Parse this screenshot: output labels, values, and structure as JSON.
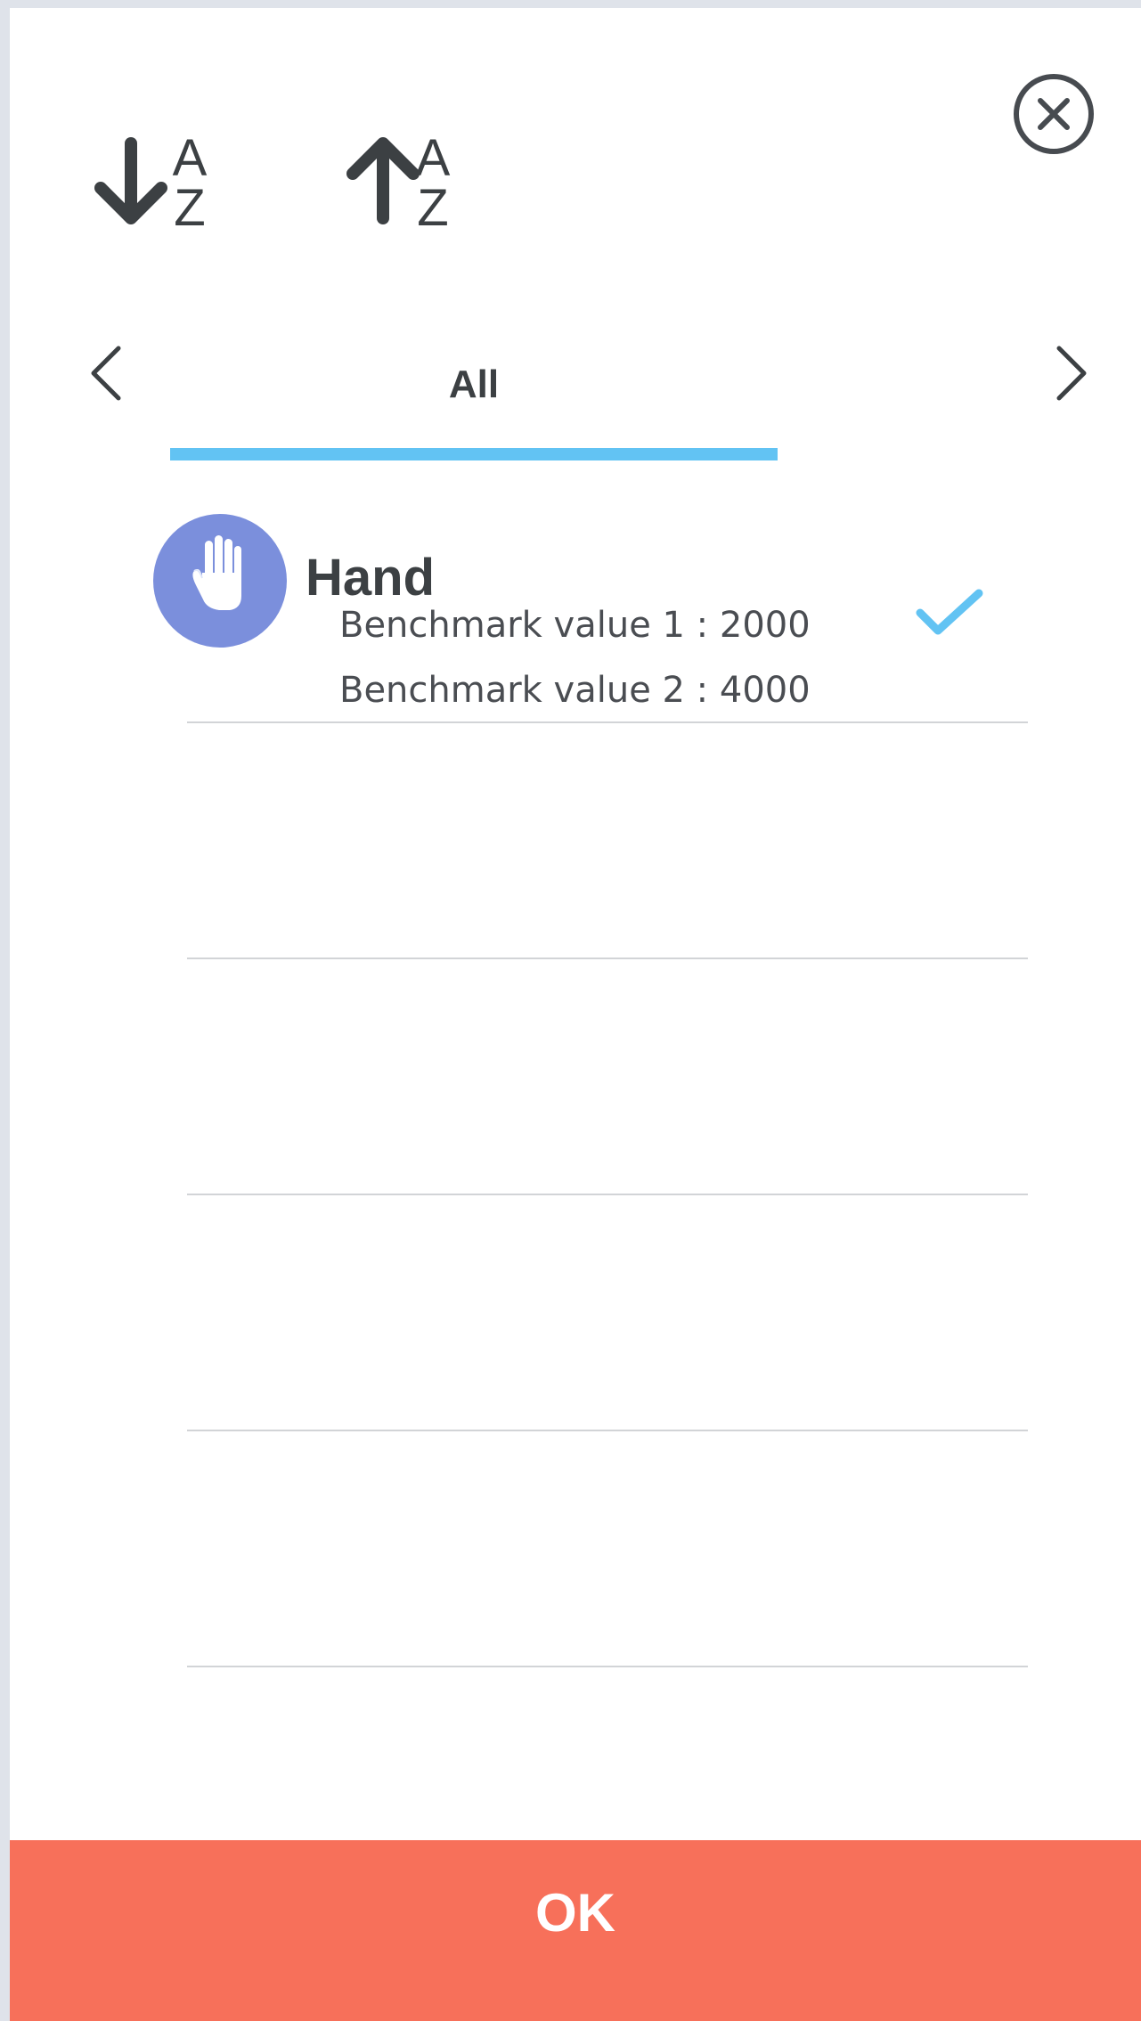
{
  "dialog": {
    "close_icon": "close-circle-icon"
  },
  "sort": {
    "descending_icon": "sort-a-z-down-icon",
    "descending_letters": [
      "A",
      "Z"
    ],
    "ascending_icon": "sort-a-z-up-icon",
    "ascending_letters": [
      "A",
      "Z"
    ]
  },
  "tabs": {
    "prev_icon": "chevron-left-icon",
    "next_icon": "chevron-right-icon",
    "active": {
      "label": "All"
    }
  },
  "items": [
    {
      "title": "Hand",
      "icon": "hand-icon",
      "subtitle_1": "Benchmark value 1 : 2000",
      "subtitle_2": "Benchmark value 2 : 4000",
      "selected": true,
      "selected_icon": "checkmark-icon"
    }
  ],
  "footer": {
    "ok_label": "OK"
  },
  "colors": {
    "accent": "#62c3f3",
    "ok_button": "#f7705a",
    "avatar": "#7b8fdc",
    "text": "#3c4043",
    "divider": "#d2d4d7"
  }
}
